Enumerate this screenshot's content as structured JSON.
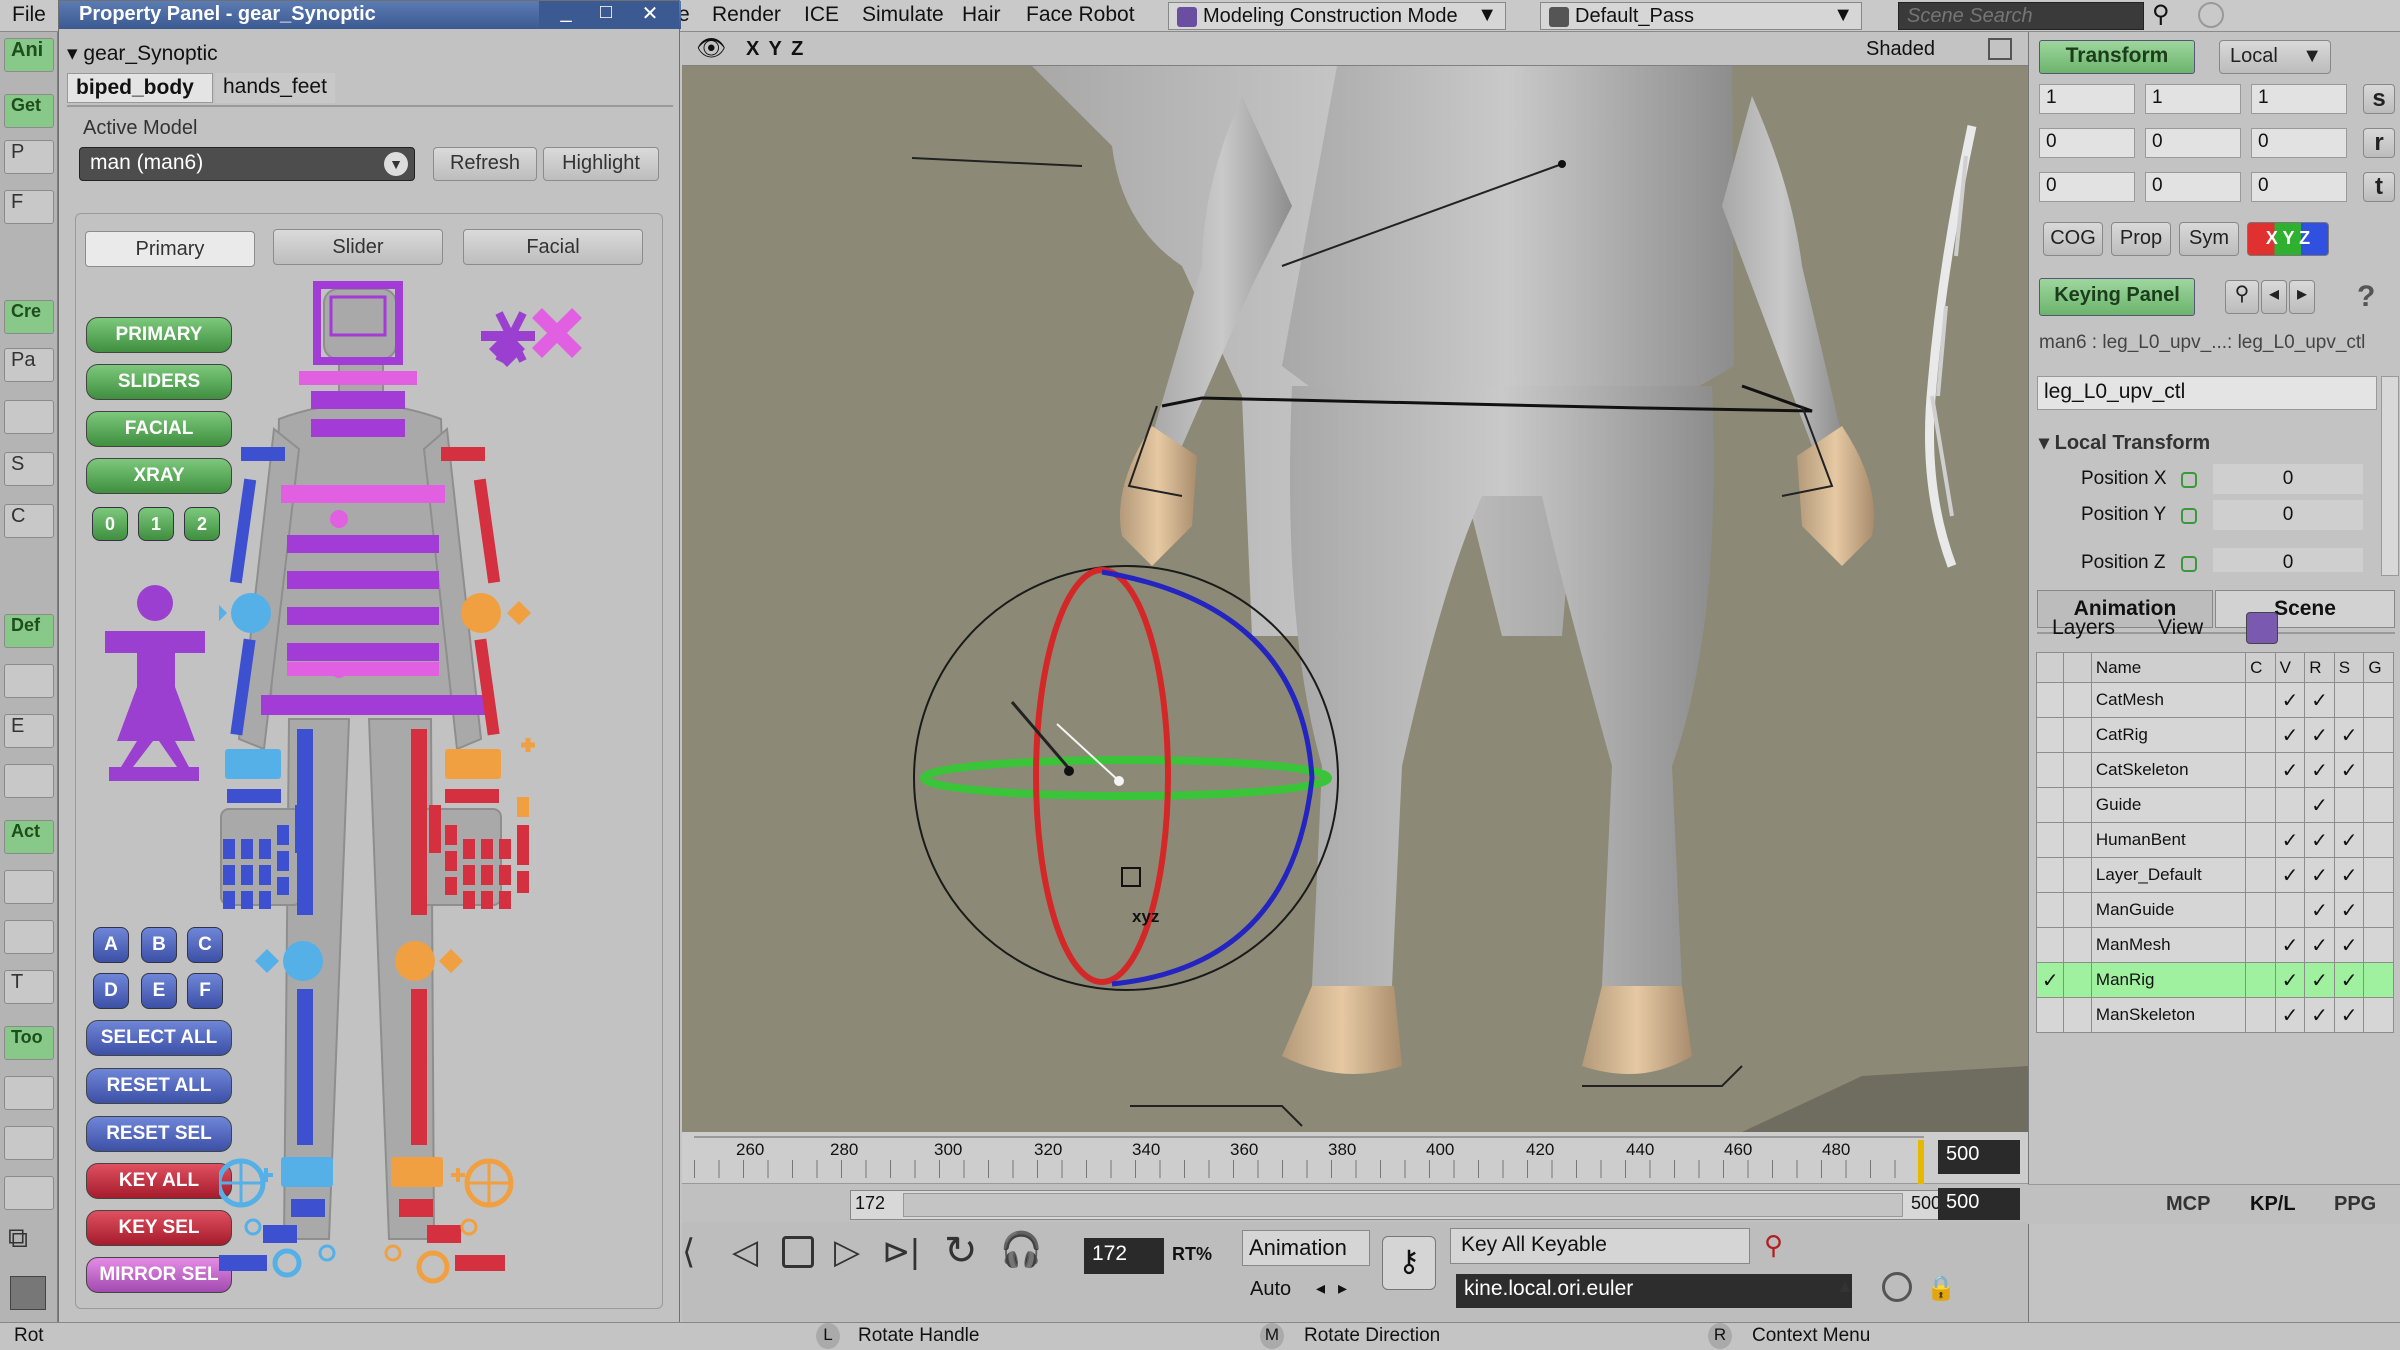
{
  "menubar": {
    "items": [
      "File",
      "e",
      "Render",
      "ICE",
      "Simulate",
      "Hair",
      "Face Robot"
    ],
    "mode_dropdown": "Modeling Construction Mode",
    "pass_dropdown": "Default_Pass",
    "search_placeholder": "Scene Search"
  },
  "left_strip": {
    "items": [
      "Ani",
      "Get",
      "P",
      "F",
      "Cre",
      "Pa",
      "",
      "S",
      "C",
      "Def",
      "",
      "E",
      "",
      "Act",
      "",
      "",
      "T",
      "Too",
      "",
      "",
      ""
    ]
  },
  "property_panel": {
    "title": "Property Panel - gear_Synoptic",
    "node": "gear_Synoptic",
    "tabs": [
      "biped_body",
      "hands_feet"
    ],
    "active_model_label": "Active Model",
    "active_model_value": "man (man6)",
    "refresh_label": "Refresh",
    "highlight_label": "Highlight",
    "subtabs": [
      "Primary",
      "Slider",
      "Facial"
    ],
    "mode_buttons": [
      "PRIMARY",
      "SLIDERS",
      "FACIAL",
      "XRAY"
    ],
    "number_buttons": [
      "0",
      "1",
      "2"
    ],
    "letter_buttons": [
      "A",
      "B",
      "C",
      "D",
      "E",
      "F"
    ],
    "action_buttons": [
      "SELECT ALL",
      "RESET ALL",
      "RESET SEL",
      "KEY ALL",
      "KEY SEL",
      "MIRROR SEL"
    ]
  },
  "viewport": {
    "axes_label": "X Y Z",
    "shading": "Shaded",
    "gizmo_label": "xyz"
  },
  "timeline": {
    "ticks": [
      "260",
      "280",
      "300",
      "320",
      "340",
      "360",
      "380",
      "400",
      "420",
      "440",
      "460",
      "480"
    ],
    "end_frame": "500",
    "start_field": "172",
    "range_end": "500",
    "range_end_field": "500"
  },
  "transport": {
    "current_frame": "172",
    "rt_label": "RT%",
    "animation_label": "Animation",
    "auto_label": "Auto",
    "key_all_keyable": "Key All Keyable",
    "param_path": "kine.local.ori.euler"
  },
  "statusbar": {
    "left_text": "Rot",
    "l_key": "L",
    "l_action": "Rotate Handle",
    "m_key": "M",
    "m_action": "Rotate Direction",
    "r_key": "R",
    "r_action": "Context Menu"
  },
  "right_panel": {
    "transform_tab": "Transform",
    "space_dropdown": "Local",
    "scale_values": [
      "1",
      "1",
      "1"
    ],
    "rotate_values": [
      "0",
      "0",
      "0"
    ],
    "translate_values": [
      "0",
      "0",
      "0"
    ],
    "srt_labels": [
      "s",
      "r",
      "t"
    ],
    "cog_label": "COG",
    "prop_label": "Prop",
    "sym_label": "Sym",
    "xyz_label": "X Y Z",
    "keying_panel": "Keying Panel",
    "help_label": "?",
    "selection_path": "man6 : leg_L0_upv_...: leg_L0_upv_ctl",
    "selected_object": "leg_L0_upv_ctl",
    "local_transform_header": "Local Transform",
    "params": [
      {
        "label": "Position X",
        "value": "0"
      },
      {
        "label": "Position Y",
        "value": "0"
      },
      {
        "label": "Position Z",
        "value": "0"
      }
    ],
    "anim_tab": "Animation",
    "scene_tab": "Scene",
    "layers_label": "Layers",
    "view_label": "View",
    "table_headers": [
      "Name",
      "C",
      "V",
      "R",
      "S",
      "G"
    ],
    "layers": [
      {
        "name": "CatMesh",
        "sel": "",
        "V": "✓",
        "R": "✓",
        "S": ""
      },
      {
        "name": "CatRig",
        "sel": "",
        "V": "✓",
        "R": "✓",
        "S": "✓"
      },
      {
        "name": "CatSkeleton",
        "sel": "",
        "V": "✓",
        "R": "✓",
        "S": "✓"
      },
      {
        "name": "Guide",
        "sel": "",
        "V": "",
        "R": "✓",
        "S": ""
      },
      {
        "name": "HumanBent",
        "sel": "",
        "V": "✓",
        "R": "✓",
        "S": "✓"
      },
      {
        "name": "Layer_Default",
        "sel": "",
        "V": "✓",
        "R": "✓",
        "S": "✓"
      },
      {
        "name": "ManGuide",
        "sel": "",
        "V": "",
        "R": "✓",
        "S": "✓"
      },
      {
        "name": "ManMesh",
        "sel": "",
        "V": "✓",
        "R": "✓",
        "S": "✓"
      },
      {
        "name": "ManRig",
        "sel": "✓",
        "V": "✓",
        "R": "✓",
        "S": "✓"
      },
      {
        "name": "ManSkeleton",
        "sel": "",
        "V": "✓",
        "R": "✓",
        "S": "✓"
      }
    ],
    "bottom_buttons": [
      "MCP",
      "KP/L",
      "PPG"
    ]
  },
  "colors": {
    "accent_green": "#7cc87c",
    "synoptic_blue": "#3c50a5",
    "synoptic_red": "#d43040",
    "synoptic_purple": "#9a3fcf",
    "synoptic_orange": "#f0a040",
    "title_bar": "#3c5a92"
  }
}
